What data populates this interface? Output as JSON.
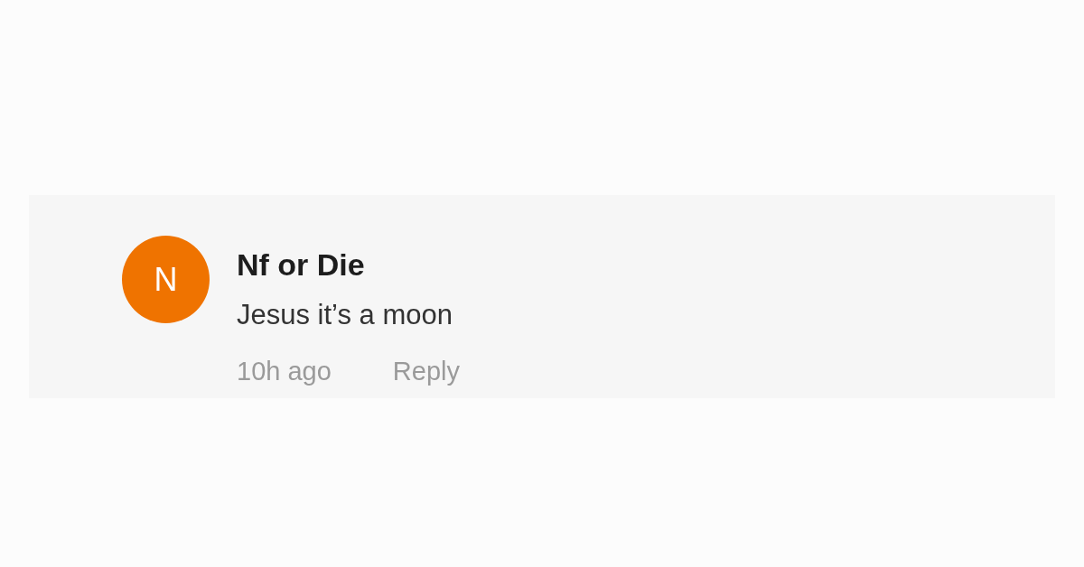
{
  "comment": {
    "avatar_initial": "N",
    "author": "Nf or Die",
    "text": "Jesus it’s a moon",
    "time": "10h ago",
    "reply": "Reply"
  }
}
